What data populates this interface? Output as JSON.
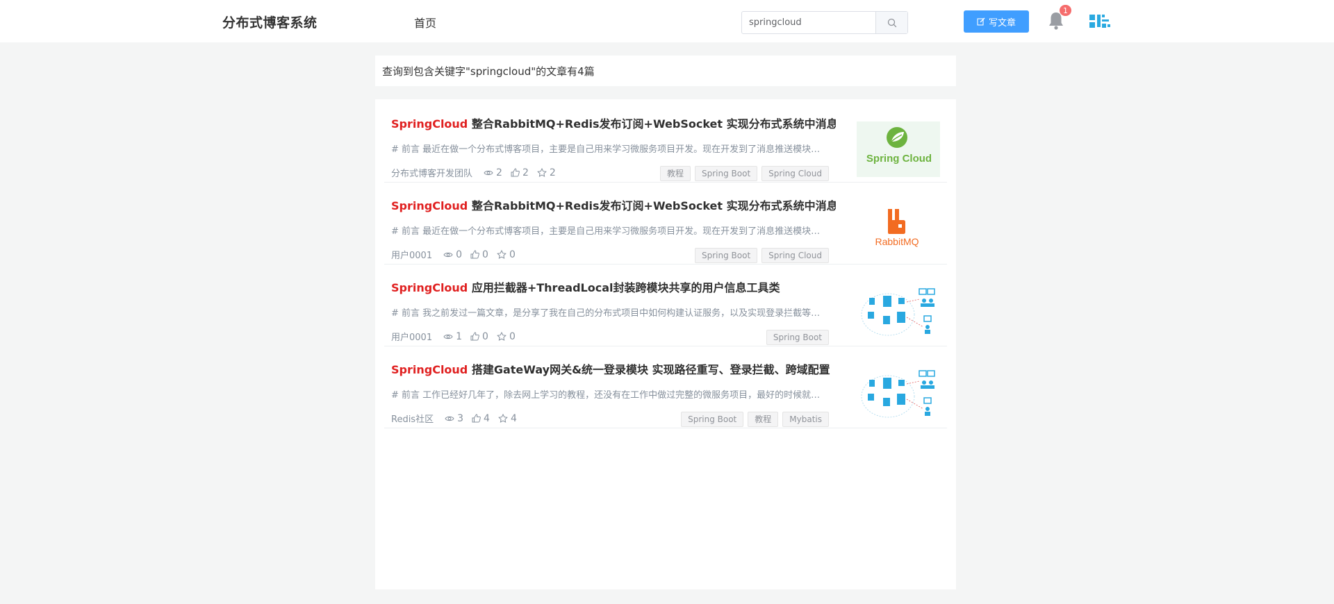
{
  "header": {
    "logo": "分布式博客系统",
    "nav_home": "首页",
    "search_value": "springcloud",
    "write_label": "写文章",
    "notification_count": "1"
  },
  "result": {
    "text": "查询到包含关键字\"springcloud\"的文章有4篇"
  },
  "colors": {
    "accent": "#409eff",
    "keyword": "#e02020",
    "badge": "#f56c6c"
  },
  "articles": [
    {
      "title_keyword": "SpringCloud",
      "title_rest": " 整合RabbitMQ+Redis发布订阅+WebSocket 实现分布式系统中消息推送",
      "summary": "# 前言 最近在做一个分布式博客项目，主要是自己用来学习微服务项目开发。现在开发到了消息推送模块，需要实现用户之间的消息推送",
      "author": "分布式博客开发团队",
      "views": "2",
      "likes": "2",
      "stars": "2",
      "tags": [
        "教程",
        "Spring Boot",
        "Spring Cloud"
      ],
      "thumb": "spring-cloud-logo",
      "thumb_text": "Spring Cloud"
    },
    {
      "title_keyword": "SpringCloud",
      "title_rest": " 整合RabbitMQ+Redis发布订阅+WebSocket 实现分布式系统中消息推送",
      "summary": "# 前言 最近在做一个分布式博客项目，主要是自己用来学习微服务项目开发。现在开发到了消息推送模块，需要实现用户之间的消息推送",
      "author": "用户0001",
      "views": "0",
      "likes": "0",
      "stars": "0",
      "tags": [
        "Spring Boot",
        "Spring Cloud"
      ],
      "thumb": "rabbitmq-logo",
      "thumb_text": "RabbitMQ"
    },
    {
      "title_keyword": "SpringCloud",
      "title_rest": " 应用拦截器+ThreadLocal封装跨模块共享的用户信息工具类",
      "summary": "# 前言 我之前发过一篇文章，是分享了我在自己的分布式项目中如何构建认证服务，以及实现登录拦截等功能的实现过程",
      "author": "用户0001",
      "views": "1",
      "likes": "0",
      "stars": "0",
      "tags": [
        "Spring Boot"
      ],
      "thumb": "microservice-diagram"
    },
    {
      "title_keyword": "SpringCloud",
      "title_rest": " 搭建GateWay网关&统一登录模块 实现路径重写、登录拦截、跨域配置",
      "summary": "# 前言 工作已经好几年了，除去网上学习的教程，还没有在工作中做过完整的微服务项目，最好的时候就是自己动手写一个",
      "author": "Redis社区",
      "views": "3",
      "likes": "4",
      "stars": "4",
      "tags": [
        "Spring Boot",
        "教程",
        "Mybatis"
      ],
      "thumb": "microservice-diagram"
    }
  ]
}
